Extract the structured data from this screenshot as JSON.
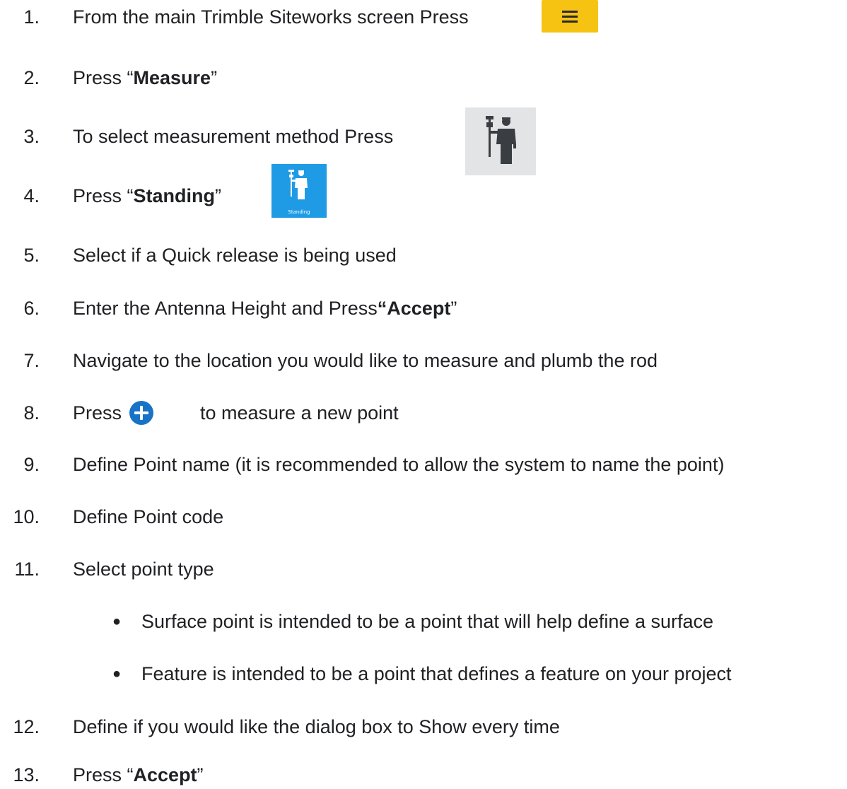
{
  "steps": [
    {
      "num": "1.",
      "text": "From the main Trimble Siteworks screen Press"
    },
    {
      "num": "2.",
      "pre": "Press “",
      "bold": "Measure",
      "post": "”"
    },
    {
      "num": "3.",
      "text": "To select measurement method Press"
    },
    {
      "num": "4.",
      "pre": "Press “",
      "bold": "Standing",
      "post": "”"
    },
    {
      "num": "5.",
      "text": "Select if a Quick release is being used"
    },
    {
      "num": "6.",
      "pre": "Enter the Antenna Height and Press ",
      "bold": "“Accept",
      "post": "”"
    },
    {
      "num": "7.",
      "text": "Navigate to the location you would like to measure and plumb the rod"
    },
    {
      "num": "8.",
      "pre": "Press",
      "post": "to measure a new point"
    },
    {
      "num": "9.",
      "text": "Define Point name (it is recommended to allow the system to name the point)"
    },
    {
      "num": "10.",
      "text": "Define Point code"
    },
    {
      "num": "11.",
      "text": "Select point type"
    },
    {
      "num": "12.",
      "text": "Define if you would like the dialog box to Show every time"
    },
    {
      "num": "13.",
      "pre": "Press “",
      "bold": "Accept",
      "post": "”"
    }
  ],
  "bullets": [
    {
      "mark": "●",
      "text": "Surface point is intended to be a point that will help define a surface"
    },
    {
      "mark": "●",
      "text": "Feature is intended to be a point that defines a feature on your project"
    }
  ],
  "icons": {
    "menu": "hamburger-menu-icon",
    "method": "measurement-method-person-icon",
    "standing": "standing-person-icon",
    "standing_label": "Standing",
    "plus": "plus-circle-icon"
  },
  "colors": {
    "menu_bg": "#f7c312",
    "method_bg": "#e3e4e6",
    "standing_bg": "#1f9be6",
    "plus": "#1873c6"
  }
}
